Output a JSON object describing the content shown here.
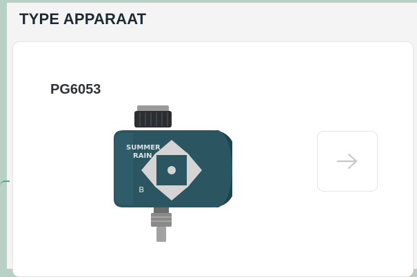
{
  "section": {
    "title": "TYPE APPARAAT"
  },
  "device": {
    "model": "PG6053",
    "brand_logo_text": "SUMMER RAIN",
    "image_icon": "garden-water-timer-image",
    "next_icon": "arrow-right-icon"
  },
  "colors": {
    "background": "#b9d0c6",
    "panel": "#f4f4f4",
    "title": "#1e2a33",
    "device_body": "#2a5561",
    "arrow": "#c8c8c8"
  }
}
